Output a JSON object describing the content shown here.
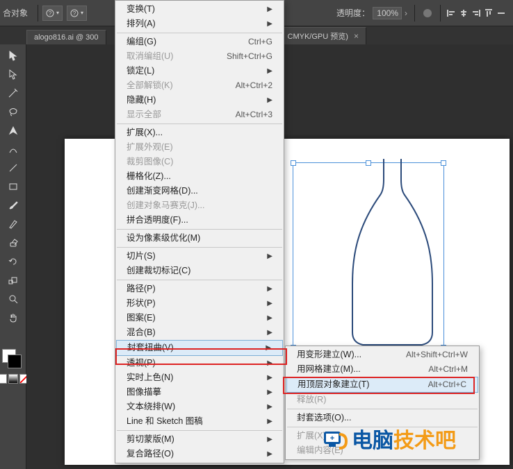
{
  "toolbar": {
    "label_left": "合对象",
    "opacity_label": "透明度：",
    "opacity_value": "100%"
  },
  "tabs": {
    "doc1": "alogo816.ai @ 300",
    "doc2_suffix": "CMYK/GPU 预览)"
  },
  "menu_main": [
    {
      "type": "item",
      "label": "变换(T)",
      "arrow": true
    },
    {
      "type": "item",
      "label": "排列(A)",
      "arrow": true
    },
    {
      "type": "sep"
    },
    {
      "type": "item",
      "label": "编组(G)",
      "shortcut": "Ctrl+G"
    },
    {
      "type": "item",
      "label": "取消编组(U)",
      "shortcut": "Shift+Ctrl+G",
      "disabled": true
    },
    {
      "type": "item",
      "label": "锁定(L)",
      "arrow": true
    },
    {
      "type": "item",
      "label": "全部解锁(K)",
      "shortcut": "Alt+Ctrl+2",
      "disabled": true
    },
    {
      "type": "item",
      "label": "隐藏(H)",
      "arrow": true
    },
    {
      "type": "item",
      "label": "显示全部",
      "shortcut": "Alt+Ctrl+3",
      "disabled": true
    },
    {
      "type": "sep"
    },
    {
      "type": "item",
      "label": "扩展(X)..."
    },
    {
      "type": "item",
      "label": "扩展外观(E)",
      "disabled": true
    },
    {
      "type": "item",
      "label": "裁剪图像(C)",
      "disabled": true
    },
    {
      "type": "item",
      "label": "栅格化(Z)..."
    },
    {
      "type": "item",
      "label": "创建渐变网格(D)..."
    },
    {
      "type": "item",
      "label": "创建对象马赛克(J)...",
      "disabled": true
    },
    {
      "type": "item",
      "label": "拼合透明度(F)..."
    },
    {
      "type": "sep"
    },
    {
      "type": "item",
      "label": "设为像素级优化(M)"
    },
    {
      "type": "sep"
    },
    {
      "type": "item",
      "label": "切片(S)",
      "arrow": true
    },
    {
      "type": "item",
      "label": "创建裁切标记(C)"
    },
    {
      "type": "sep"
    },
    {
      "type": "item",
      "label": "路径(P)",
      "arrow": true
    },
    {
      "type": "item",
      "label": "形状(P)",
      "arrow": true
    },
    {
      "type": "item",
      "label": "图案(E)",
      "arrow": true
    },
    {
      "type": "item",
      "label": "混合(B)",
      "arrow": true
    },
    {
      "type": "item",
      "label": "封套扭曲(V)",
      "arrow": true,
      "highlight": true
    },
    {
      "type": "item",
      "label": "透视(P)",
      "arrow": true
    },
    {
      "type": "item",
      "label": "实时上色(N)",
      "arrow": true
    },
    {
      "type": "item",
      "label": "图像描摹",
      "arrow": true
    },
    {
      "type": "item",
      "label": "文本绕排(W)",
      "arrow": true
    },
    {
      "type": "item",
      "label": "Line 和 Sketch 图稿",
      "arrow": true
    },
    {
      "type": "sep"
    },
    {
      "type": "item",
      "label": "剪切蒙版(M)",
      "arrow": true
    },
    {
      "type": "item",
      "label": "复合路径(O)",
      "arrow": true
    }
  ],
  "menu_sub": [
    {
      "type": "item",
      "label": "用变形建立(W)...",
      "shortcut": "Alt+Shift+Ctrl+W"
    },
    {
      "type": "item",
      "label": "用网格建立(M)...",
      "shortcut": "Alt+Ctrl+M"
    },
    {
      "type": "item",
      "label": "用顶层对象建立(T)",
      "shortcut": "Alt+Ctrl+C",
      "highlight": true
    },
    {
      "type": "item",
      "label": "释放(R)",
      "disabled": true
    },
    {
      "type": "sep"
    },
    {
      "type": "item",
      "label": "封套选项(O)..."
    },
    {
      "type": "sep"
    },
    {
      "type": "item",
      "label": "扩展(X)",
      "disabled": true
    },
    {
      "type": "item",
      "label": "编辑内容(E)",
      "disabled": true
    }
  ],
  "watermark": {
    "t1": "电脑",
    "t2": "技术吧"
  }
}
